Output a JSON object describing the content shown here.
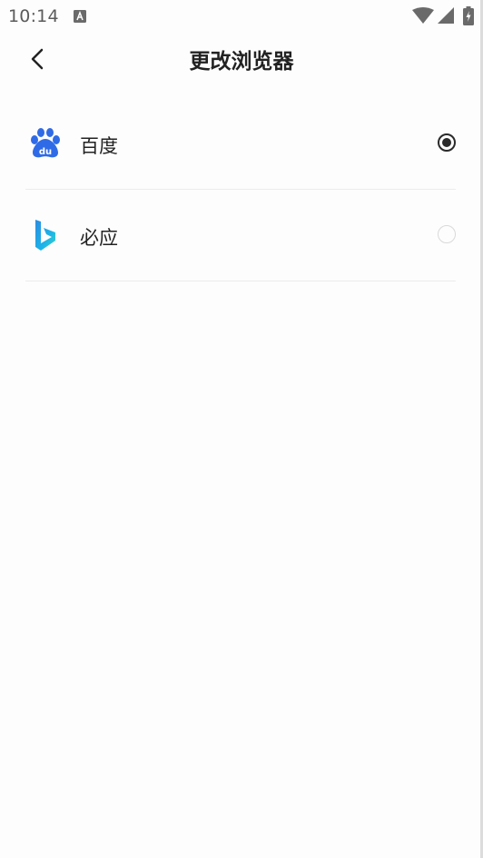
{
  "status_bar": {
    "time": "10:14",
    "notification_icon": "a-notification-icon",
    "wifi_icon": "wifi-icon",
    "signal_icon": "cell-signal-icon",
    "battery_icon": "battery-charging-icon"
  },
  "header": {
    "title": "更改浏览器",
    "back_icon": "chevron-left-icon"
  },
  "options": [
    {
      "label": "百度",
      "icon": "baidu-logo-icon",
      "selected": true,
      "brand_color": "#2F6BE6"
    },
    {
      "label": "必应",
      "icon": "bing-logo-icon",
      "selected": false,
      "brand_color": "#1E9BE0"
    }
  ],
  "colors": {
    "background": "#FDFDFD",
    "divider": "#ECECEC",
    "radio_checked": "#2A2A2A",
    "radio_unchecked": "#D9D9D9"
  }
}
